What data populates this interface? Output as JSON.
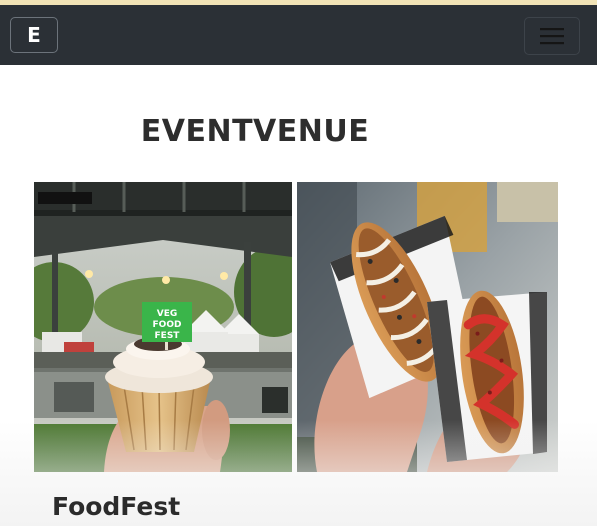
{
  "navbar": {
    "brand_letter": "E",
    "menu_icon": "hamburger-menu-icon",
    "background": "#2b3036"
  },
  "page": {
    "title": "EVENTVENUE"
  },
  "gallery": {
    "photos": [
      {
        "name": "cupcake-bandstand-photo",
        "sign_text": "VEG FOOD FEST"
      },
      {
        "name": "hotdogs-photo"
      }
    ]
  },
  "event": {
    "name": "FoodFest"
  }
}
